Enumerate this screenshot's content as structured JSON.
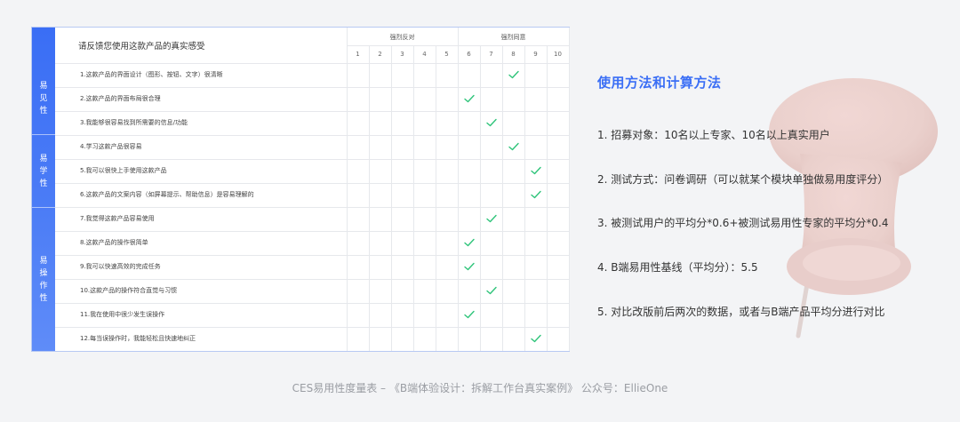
{
  "survey": {
    "title": "请反馈您使用这款产品的真实感受",
    "groups": {
      "disagree": "强烈反对",
      "agree": "强烈同意"
    },
    "scale": [
      "1",
      "2",
      "3",
      "4",
      "5",
      "6",
      "7",
      "8",
      "9",
      "10"
    ],
    "categories": [
      {
        "lines": [
          "易",
          "见",
          "性"
        ]
      },
      {
        "lines": [
          "易",
          "学",
          "性"
        ]
      },
      {
        "lines": [
          "易",
          "操",
          "作",
          "性"
        ]
      }
    ],
    "questions": [
      {
        "text": "1.这款产品的界面设计（图形、按钮、文字）很清晰",
        "rating": 8
      },
      {
        "text": "2.这款产品的界面布局很合理",
        "rating": 6
      },
      {
        "text": "3.我能够很容易找到所需要的信息/功能",
        "rating": 7
      },
      {
        "text": "4.学习这款产品很容易",
        "rating": 8
      },
      {
        "text": "5.我可以很快上手使用这款产品",
        "rating": 9
      },
      {
        "text": "6.这款产品的文案内容（如屏幕提示、帮助信息）是容易理解的",
        "rating": 9
      },
      {
        "text": "7.我觉得这款产品容易使用",
        "rating": 7
      },
      {
        "text": "8.这款产品的操作很简单",
        "rating": 6
      },
      {
        "text": "9.我可以快速高效的完成任务",
        "rating": 6
      },
      {
        "text": "10.这款产品的操作符合直觉与习惯",
        "rating": 7
      },
      {
        "text": "11.我在使用中很少发生误操作",
        "rating": 6
      },
      {
        "text": "12.每当误操作时，我能轻松且快速地纠正",
        "rating": 9
      }
    ]
  },
  "method": {
    "title": "使用方法和计算方法",
    "items": [
      "1. 招募对象：10名以上专家、10名以上真实用户",
      "2. 测试方式：问卷调研（可以就某个模块单独做易用度评分）",
      "3. 被测试用户的平均分*0.6+被测试易用性专家的平均分*0.4",
      "4. B端易用性基线（平均分）：5.5",
      "5. 对比改版前后两次的数据，或者与B端产品平均分进行对比"
    ]
  },
  "caption": "CES易用性度量表 – 《B端体验设计：拆解工作台真实案例》 公众号：EllieOne",
  "colors": {
    "accent": "#3a6ef5",
    "check": "#2fc47a",
    "background": "#f3f4f6"
  },
  "icons": {
    "check": "check-icon",
    "decoration": "pushpin-icon"
  }
}
